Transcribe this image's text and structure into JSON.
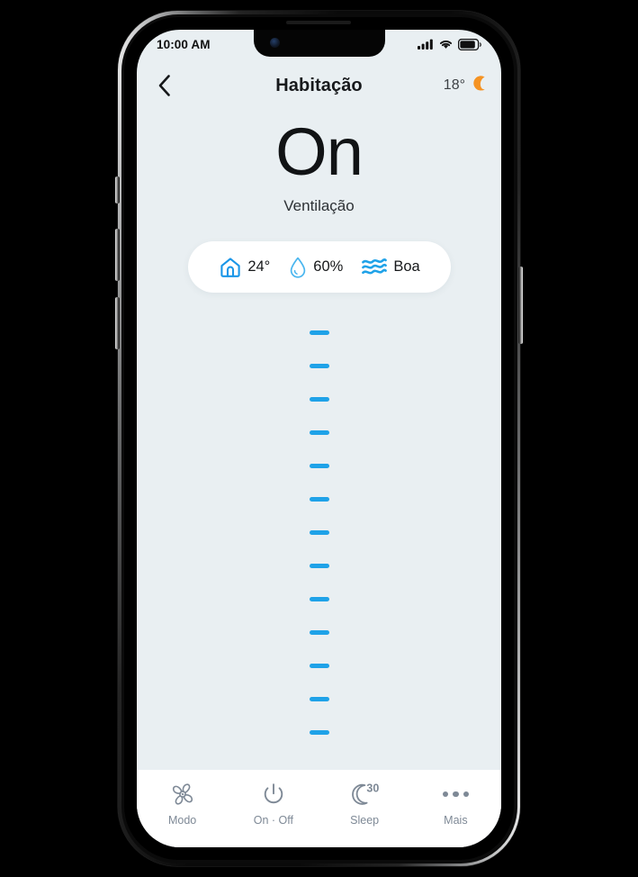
{
  "status_bar": {
    "time": "10:00 AM",
    "signal_icon": "cellular-signal-icon",
    "wifi_icon": "wifi-icon",
    "battery_icon": "battery-icon"
  },
  "header": {
    "back_icon": "chevron-left-icon",
    "title": "Habitação",
    "outdoor_temp": "18°",
    "weather_icon": "crescent-moon-icon",
    "weather_icon_color": "#f59323"
  },
  "main": {
    "power_state": "On",
    "mode_label": "Ventilação",
    "info": [
      {
        "icon": "home-icon",
        "icon_color": "#1a96e8",
        "value": "24°"
      },
      {
        "icon": "water-drop-icon",
        "icon_color": "#4ab6ef",
        "value": "60%"
      },
      {
        "icon": "air-waves-icon",
        "icon_color": "#1fa2e8",
        "value": "Boa"
      }
    ],
    "slider": {
      "tick_count": 13,
      "tick_color": "#1fa2e8"
    }
  },
  "tab_bar": {
    "items": [
      {
        "icon": "fan-icon",
        "label": "Modo"
      },
      {
        "icon": "power-icon",
        "label": "On · Off"
      },
      {
        "icon": "moon-timer-icon",
        "label": "Sleep",
        "badge": "30"
      },
      {
        "icon": "ellipsis-icon",
        "label": "Mais"
      }
    ]
  },
  "theme": {
    "screen_bg": "#e9eff2",
    "accent": "#1fa2e8",
    "card_bg": "#ffffff",
    "text_primary": "#16181a",
    "text_muted": "#7e8996"
  }
}
